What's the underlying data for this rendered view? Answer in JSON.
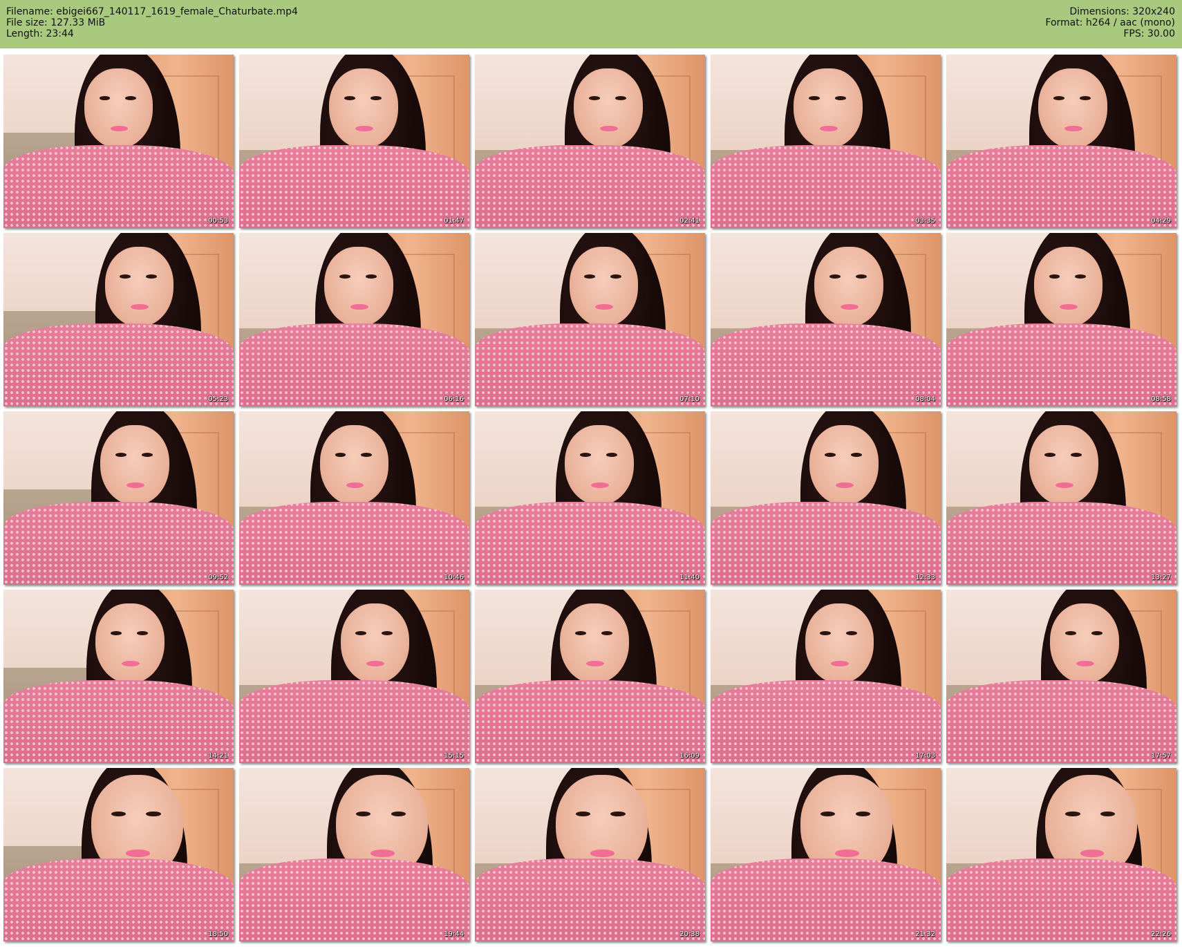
{
  "header": {
    "filename_label": "Filename: ebigei667_140117_1619_female_Chaturbate.mp4",
    "filesize_label": "File size: 127.33 MiB",
    "length_label": "Length: 23:44",
    "dimensions_label": "Dimensions: 320x240",
    "format_label": "Format: h264 / aac (mono)",
    "fps_label": "FPS: 30.00",
    "background_color": "#a9c97f"
  },
  "thumbnails": [
    {
      "time": "00:53"
    },
    {
      "time": "01:47"
    },
    {
      "time": "02:41"
    },
    {
      "time": "03:35"
    },
    {
      "time": "04:29"
    },
    {
      "time": "05:23"
    },
    {
      "time": "06:16"
    },
    {
      "time": "07:10"
    },
    {
      "time": "08:04"
    },
    {
      "time": "08:58"
    },
    {
      "time": "09:52"
    },
    {
      "time": "10:46"
    },
    {
      "time": "11:40"
    },
    {
      "time": "12:33"
    },
    {
      "time": "13:27"
    },
    {
      "time": "14:21"
    },
    {
      "time": "15:15"
    },
    {
      "time": "16:09"
    },
    {
      "time": "17:03"
    },
    {
      "time": "17:57"
    },
    {
      "time": "18:50"
    },
    {
      "time": "19:44"
    },
    {
      "time": "20:38"
    },
    {
      "time": "21:32"
    },
    {
      "time": "22:26"
    }
  ]
}
